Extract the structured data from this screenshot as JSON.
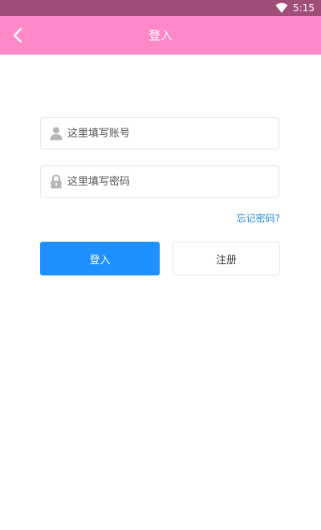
{
  "status_bar": {
    "time": "5:15",
    "wifi_icon": "wifi-icon"
  },
  "header": {
    "title": "登入",
    "back_icon": "chevron-left-icon"
  },
  "form": {
    "account": {
      "placeholder": "这里填写账号",
      "value": "",
      "icon": "user-icon"
    },
    "password": {
      "placeholder": "这里填写密码",
      "value": "",
      "icon": "lock-icon"
    },
    "forgot_label": "忘记密码?",
    "login_label": "登入",
    "register_label": "注册"
  },
  "colors": {
    "status_bar": "#a04d7a",
    "header": "#ff88c8",
    "primary": "#1e90ff",
    "link": "#1e88e5"
  }
}
